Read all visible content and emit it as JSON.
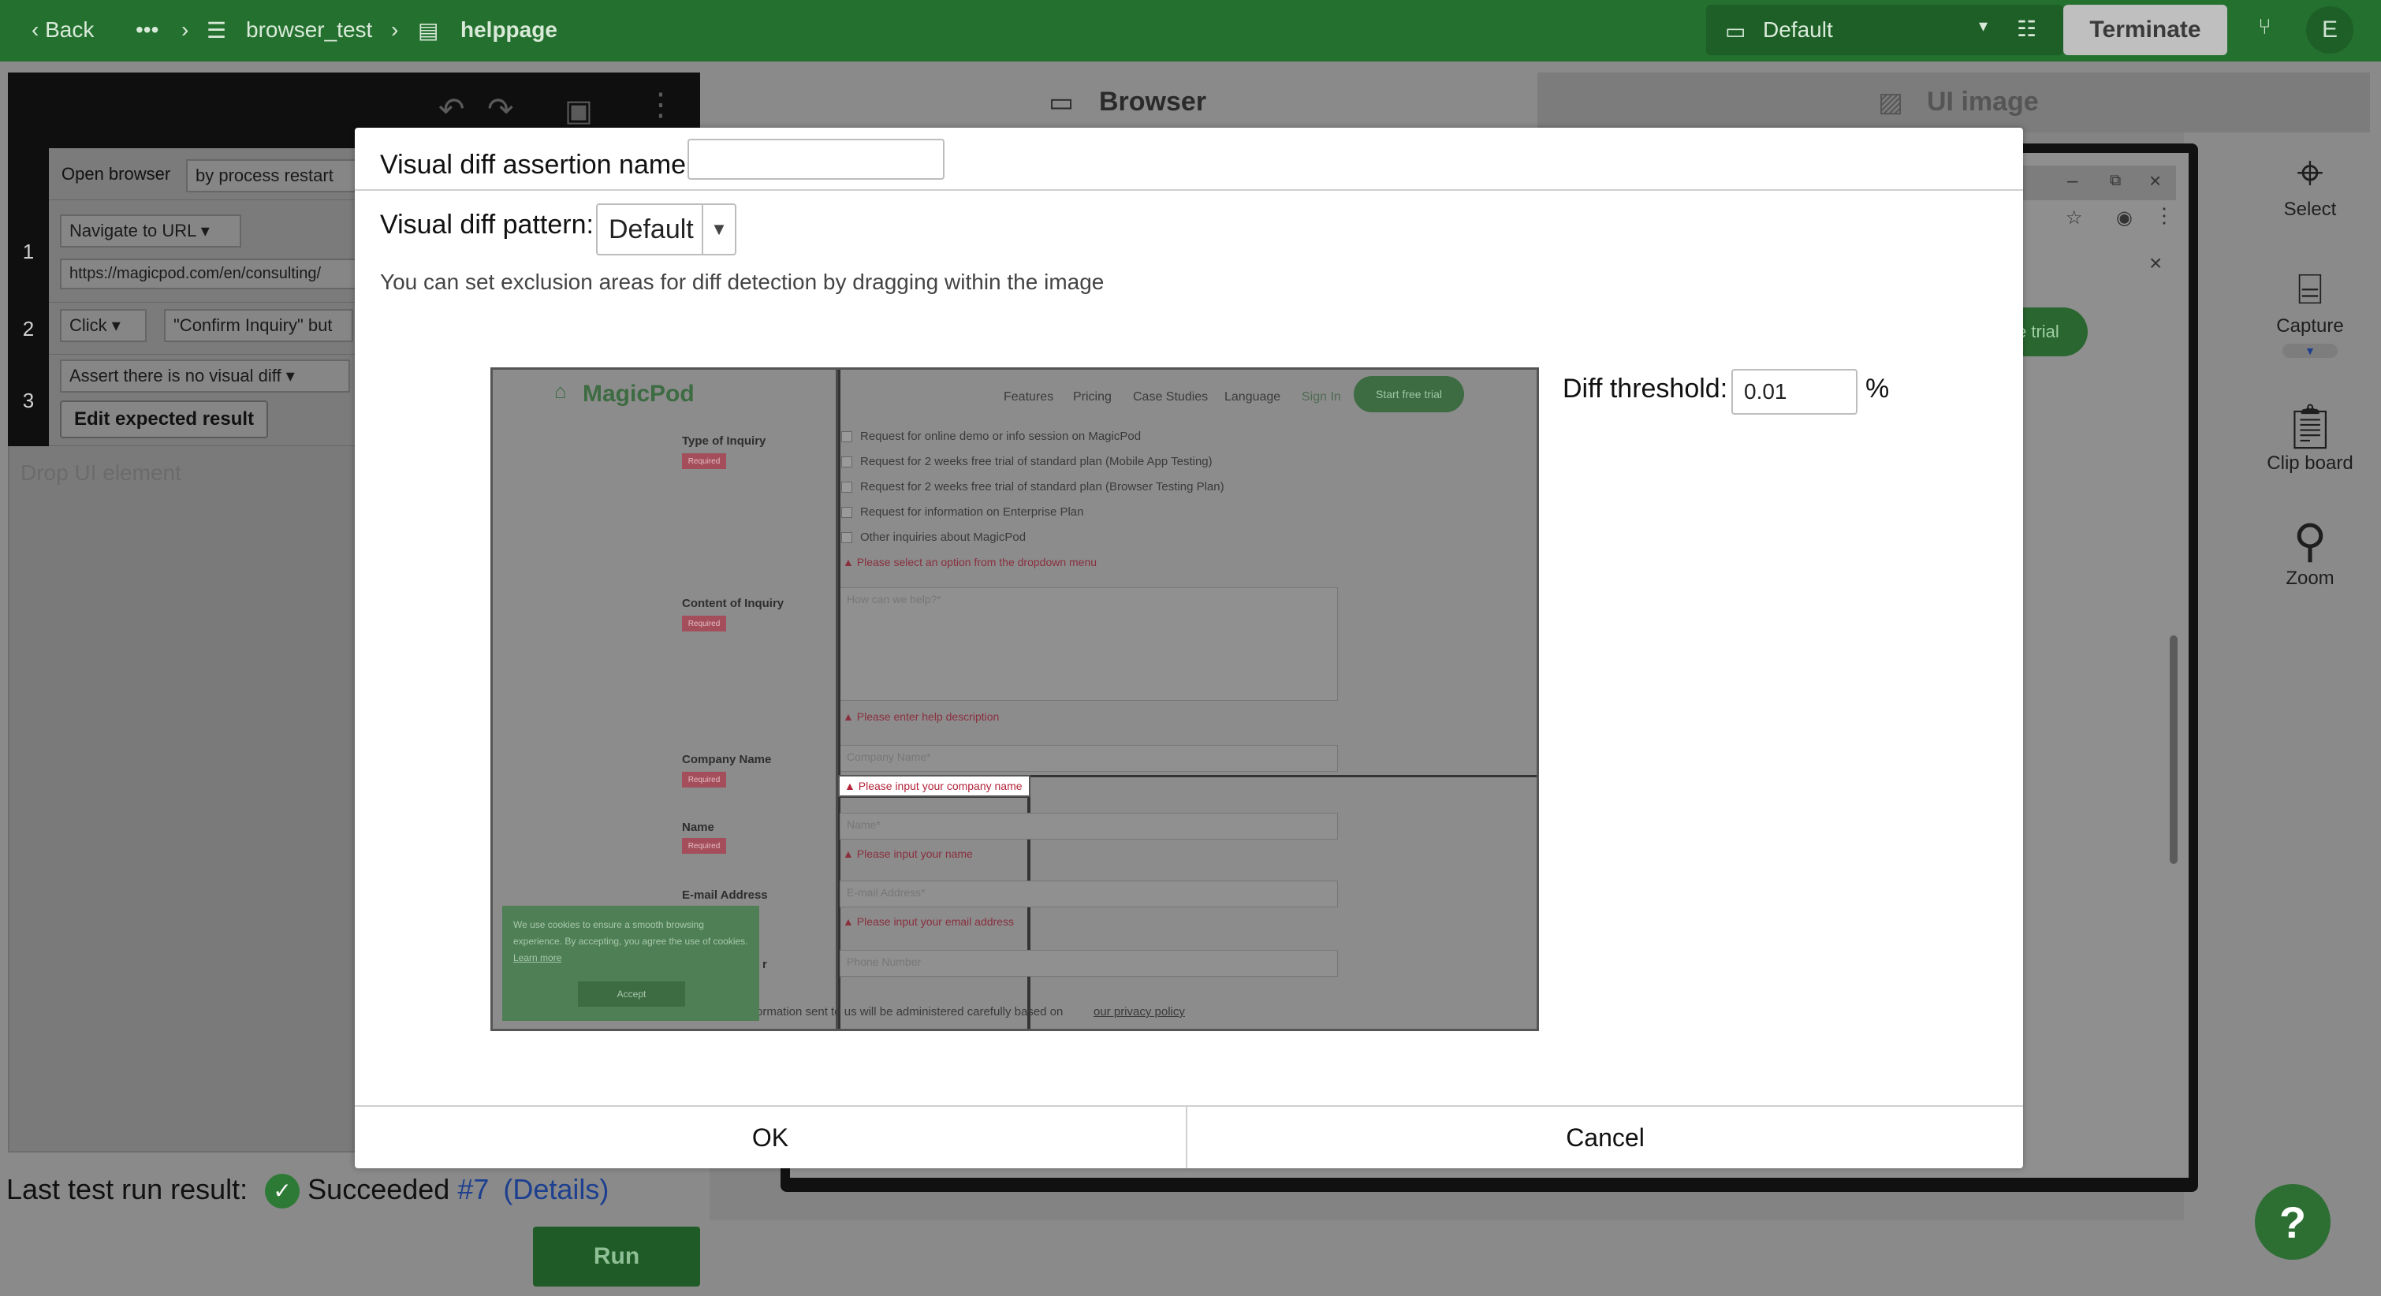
{
  "topbar": {
    "back": "Back",
    "more": "•••",
    "breadcrumb": [
      "browser_test",
      "helppage"
    ],
    "environment": "Default",
    "terminate": "Terminate",
    "avatar": "E"
  },
  "editor": {
    "steps": [
      {
        "num": "",
        "command": "Open browser",
        "arg": "by process restart"
      },
      {
        "num": "1",
        "command": "Navigate to URL",
        "value": "https://magicpod.com/en/consulting/"
      },
      {
        "num": "2",
        "command": "Click",
        "target": "\"Confirm Inquiry\" but"
      },
      {
        "num": "3",
        "command": "Assert there is no visual diff",
        "button": "Edit expected result"
      }
    ],
    "drop_hint": "Drop UI element"
  },
  "last_run": {
    "label": "Last test run result:",
    "status": "Succeeded",
    "number": "#7",
    "details": "(Details)"
  },
  "run_button": "Run",
  "tabs": {
    "browser": "Browser",
    "ui_image": "UI image"
  },
  "tools": [
    "Select",
    "Capture",
    "Clip board",
    "Zoom"
  ],
  "browser_preview": {
    "trial_fragment": "e trial"
  },
  "help_button": "?",
  "modal": {
    "name_label": "Visual diff assertion name:",
    "name_value": "",
    "pattern_label": "Visual diff pattern:",
    "pattern_value": "Default",
    "hint": "You can set exclusion areas for diff detection by dragging within the image",
    "threshold_label": "Diff threshold:",
    "threshold_value": "0.01",
    "threshold_unit": "%",
    "ok": "OK",
    "cancel": "Cancel"
  },
  "captured_page": {
    "logo": "MagicPod",
    "nav": [
      "Features",
      "Pricing",
      "Case Studies",
      "Language",
      "Sign In"
    ],
    "cta": "Start free trial",
    "required": "Required",
    "type_label": "Type of Inquiry",
    "options": [
      "Request for online demo or info session on MagicPod",
      "Request for 2 weeks free trial of standard plan (Mobile App Testing)",
      "Request for 2 weeks free trial of standard plan (Browser Testing Plan)",
      "Request for information on Enterprise Plan",
      "Other inquiries about MagicPod"
    ],
    "type_error": "Please select an option from the dropdown menu",
    "content_label": "Content of Inquiry",
    "content_placeholder": "How can we help?*",
    "content_error": "Please enter help description",
    "company_label": "Company Name",
    "company_placeholder": "Company Name*",
    "company_error": "Please input your company name",
    "name_label": "Name",
    "name_placeholder": "Name*",
    "name_error": "Please input your name",
    "email_label": "E-mail Address",
    "email_placeholder": "E-mail Address*",
    "email_error": "Please input your email address",
    "phone_label_fragment": "r",
    "phone_placeholder": "Phone Number",
    "privacy_text": "ormation sent to us will be administered carefully based on",
    "privacy_link": "our privacy policy",
    "cookie_text": "We use cookies to ensure a smooth browsing experience. By accepting, you agree the use of cookies.",
    "cookie_link": "Learn more",
    "cookie_accept": "Accept"
  }
}
